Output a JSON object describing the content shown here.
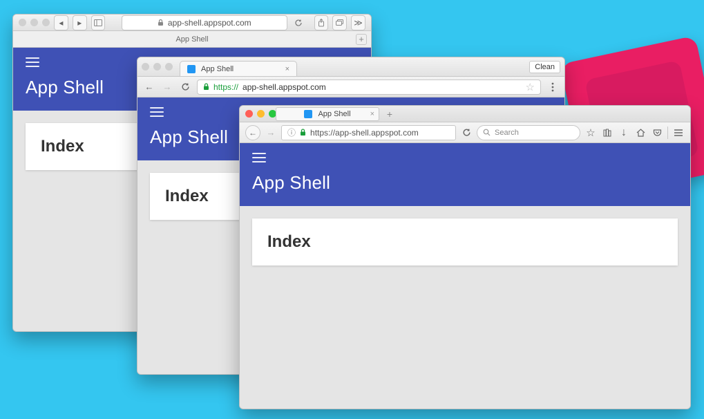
{
  "safari": {
    "url": "app-shell.appspot.com",
    "tab_title": "App Shell",
    "app_title": "App Shell",
    "card_heading": "Index"
  },
  "chrome": {
    "clean_button": "Clean",
    "tab_title": "App Shell",
    "url_scheme": "https://",
    "url_rest": "app-shell.appspot.com",
    "app_title": "App Shell",
    "card_heading": "Index"
  },
  "firefox": {
    "tab_title": "App Shell",
    "url": "https://app-shell.appspot.com",
    "search_placeholder": "Search",
    "app_title": "App Shell",
    "card_heading": "Index"
  }
}
